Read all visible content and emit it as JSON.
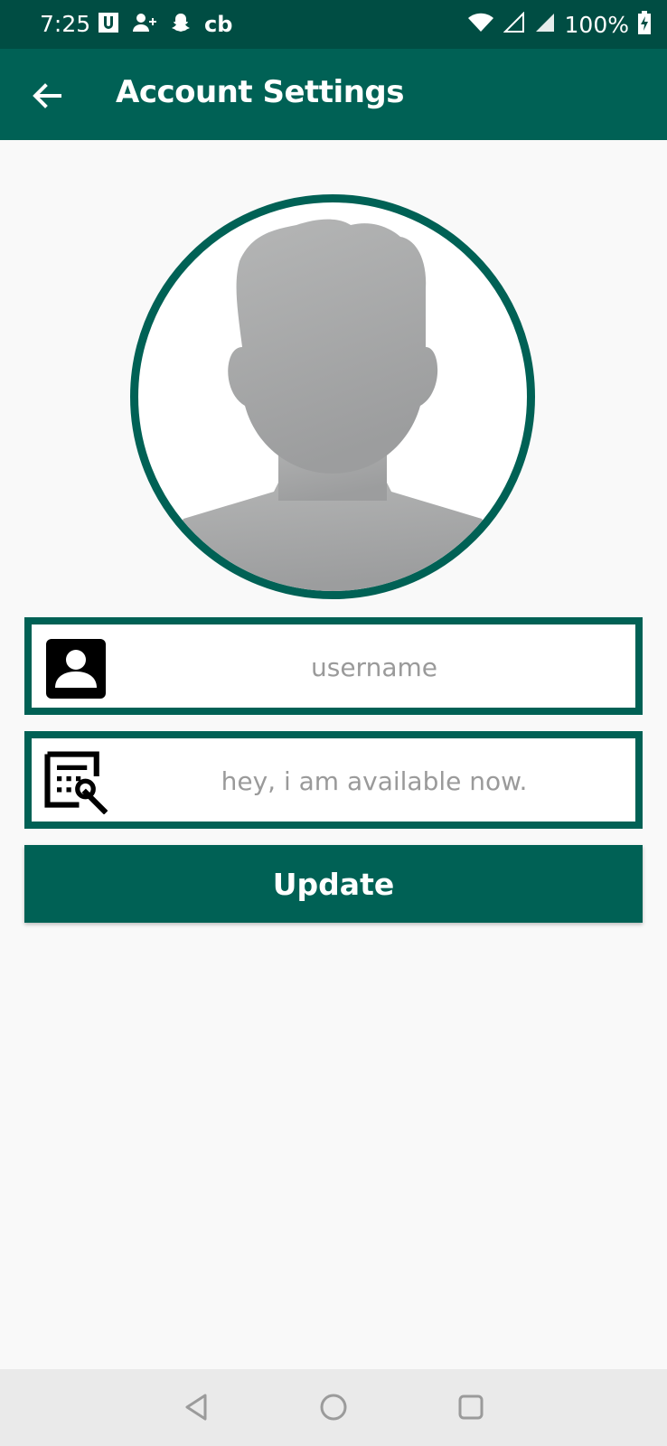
{
  "status_bar": {
    "time": "7:25",
    "left_icons": [
      "u-app-icon",
      "add-user-icon",
      "snapchat-icon",
      "cb-icon"
    ],
    "cb_label": "cb",
    "right_icons": [
      "wifi-icon",
      "signal-icon",
      "signal-full-icon",
      "battery-charging-icon"
    ],
    "battery": "100%"
  },
  "app_bar": {
    "title": "Account Settings",
    "back_icon": "arrow-left-icon"
  },
  "profile": {
    "avatar_icon": "default-avatar-silhouette"
  },
  "form": {
    "username": {
      "icon": "contact-card-icon",
      "placeholder": "username",
      "value": ""
    },
    "status": {
      "icon": "edit-note-icon",
      "placeholder": "hey, i am available now.",
      "value": ""
    },
    "update_label": "Update"
  },
  "nav_bar": {
    "icons": [
      "back-triangle-icon",
      "home-circle-icon",
      "recents-square-icon"
    ]
  },
  "colors": {
    "primary": "#006155",
    "primary_dark": "#004d43",
    "background": "#f9f9f9",
    "placeholder": "#9a9a9a"
  }
}
